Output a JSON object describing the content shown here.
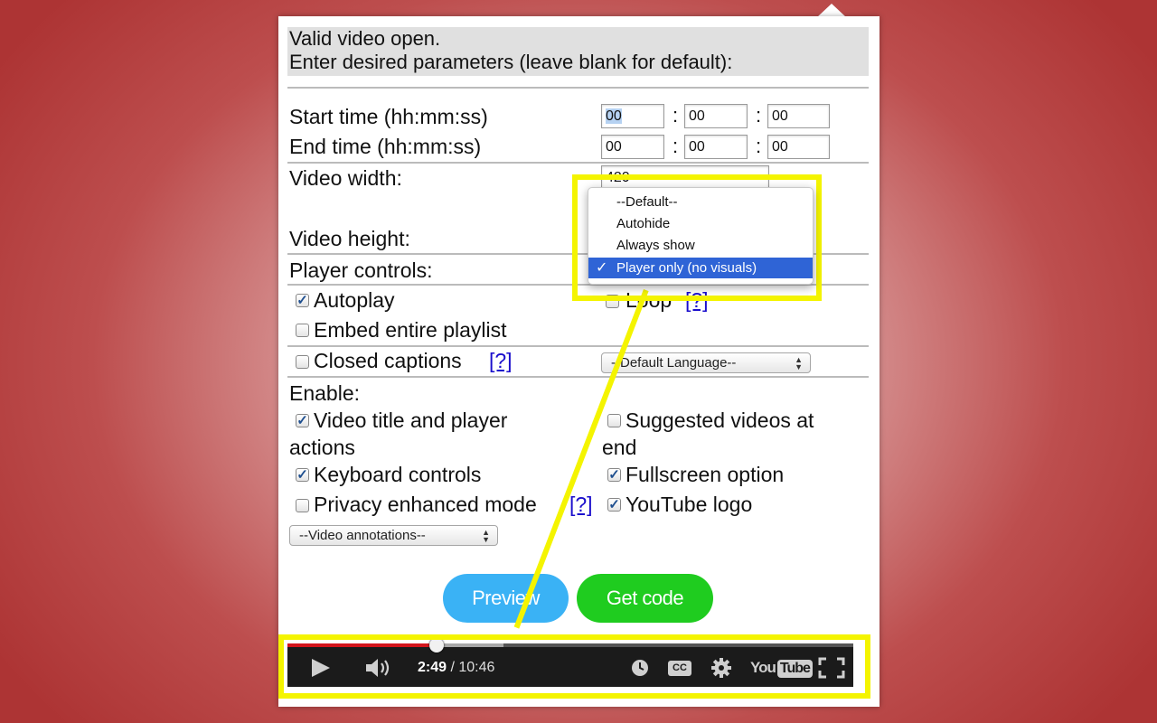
{
  "header": {
    "line1": "Valid video open.",
    "line2": "Enter desired parameters (leave blank for default):"
  },
  "start_time": {
    "label": "Start time (hh:mm:ss)",
    "hh": "00",
    "mm": "00",
    "ss": "00"
  },
  "end_time": {
    "label": "End time (hh:mm:ss)",
    "hh": "00",
    "mm": "00",
    "ss": "00"
  },
  "video_width": {
    "label": "Video width:",
    "value": "420"
  },
  "video_height": {
    "label": "Video height:"
  },
  "player_controls": {
    "label": "Player controls:"
  },
  "dropdown": {
    "options": [
      "--Default--",
      "Autohide",
      "Always show",
      "Player only (no visuals)"
    ],
    "selected": "Player only (no visuals)",
    "check_glyph": "✓"
  },
  "options": {
    "autoplay": {
      "label": "Autoplay",
      "checked": true
    },
    "loop": {
      "label": "Loop",
      "checked": false,
      "help": "[?]"
    },
    "playlist": {
      "label": "Embed entire playlist",
      "checked": false
    },
    "captions": {
      "label": "Closed captions",
      "checked": false,
      "help": "[?]"
    },
    "language": "--Default Language--"
  },
  "enable": {
    "label": "Enable:",
    "title_actions": {
      "line1": "Video title and player",
      "line2": "actions",
      "checked": true
    },
    "suggested": {
      "line1": "Suggested videos at",
      "line2": "end",
      "checked": false
    },
    "keyboard": {
      "label": "Keyboard controls",
      "checked": true
    },
    "fullscreen": {
      "label": "Fullscreen option",
      "checked": true
    },
    "privacy": {
      "label": "Privacy enhanced mode",
      "checked": false,
      "help": "[?]"
    },
    "logo": {
      "label": "YouTube logo",
      "checked": true
    }
  },
  "annotations_select": "--Video annotations--",
  "buttons": {
    "preview": "Preview",
    "get_code": "Get code"
  },
  "player": {
    "current_time": "2:49",
    "duration": "/ 10:46",
    "progress_fraction": 0.264,
    "logo_text": "YouTube"
  },
  "colors": {
    "highlight": "#f4f400",
    "preview_button": "#3ab2f5",
    "get_code_button": "#1fcc1f",
    "selected_option": "#2f64d6",
    "progress": "#d3151b"
  },
  "icons": {
    "play": "play-icon",
    "volume": "volume-icon",
    "watch_later": "clock-icon",
    "captions": "cc-icon",
    "settings": "gear-icon",
    "fullscreen": "fullscreen-icon",
    "checkmark": "checkmark-icon"
  }
}
